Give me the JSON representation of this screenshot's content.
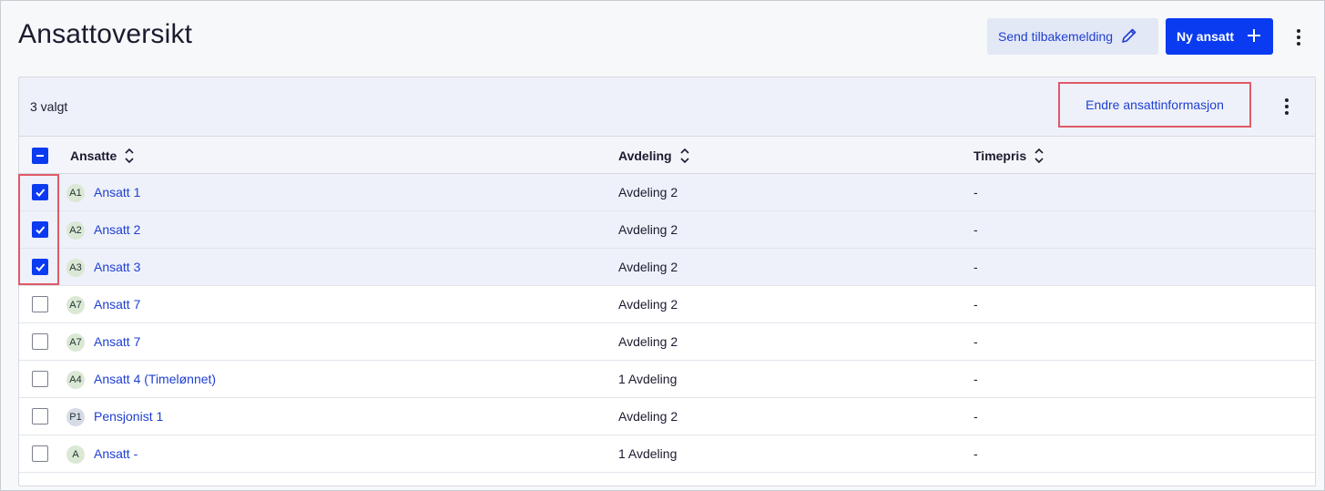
{
  "page": {
    "title": "Ansattoversikt"
  },
  "toolbar": {
    "feedback_label": "Send tilbakemelding",
    "new_label": "Ny ansatt"
  },
  "selection": {
    "count_text": "3 valgt",
    "edit_label": "Endre ansattinformasjon"
  },
  "table": {
    "columns": [
      "Ansatte",
      "Avdeling",
      "Timepris"
    ],
    "rows": [
      {
        "initials": "A1",
        "name": "Ansatt 1",
        "department": "Avdeling 2",
        "rate": "-",
        "selected": true
      },
      {
        "initials": "A2",
        "name": "Ansatt 2",
        "department": "Avdeling 2",
        "rate": "-",
        "selected": true
      },
      {
        "initials": "A3",
        "name": "Ansatt 3",
        "department": "Avdeling 2",
        "rate": "-",
        "selected": true
      },
      {
        "initials": "A7",
        "name": "Ansatt 7",
        "department": "Avdeling 2",
        "rate": "-",
        "selected": false
      },
      {
        "initials": "A7",
        "name": "Ansatt 7",
        "department": "Avdeling 2",
        "rate": "-",
        "selected": false
      },
      {
        "initials": "A4",
        "name": "Ansatt 4 (Timelønnet)",
        "department": "1 Avdeling",
        "rate": "-",
        "selected": false
      },
      {
        "initials": "P1",
        "name": "Pensjonist 1",
        "department": "Avdeling 2",
        "rate": "-",
        "selected": false
      },
      {
        "initials": "A",
        "name": "Ansatt -",
        "department": "1 Avdeling",
        "rate": "-",
        "selected": false
      }
    ]
  },
  "colors": {
    "accent": "#0a3bf0",
    "link": "#1f3fd1",
    "highlight": "#e05a67",
    "selected_row": "#eef1f9"
  },
  "icons": {
    "feedback": "pencil-icon",
    "new": "plus-icon",
    "more": "kebab-menu-icon",
    "sort": "sort-arrows-icon",
    "check": "check-icon",
    "indeterminate": "minus-icon"
  }
}
